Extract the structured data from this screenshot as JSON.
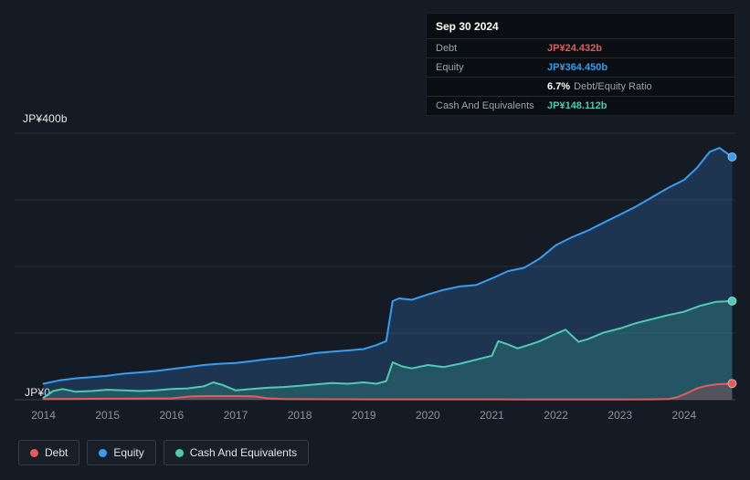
{
  "tooltip": {
    "date": "Sep 30 2024",
    "debt_label": "Debt",
    "debt_value": "JP¥24.432b",
    "equity_label": "Equity",
    "equity_value": "JP¥364.450b",
    "ratio_value": "6.7%",
    "ratio_label": "Debt/Equity Ratio",
    "cash_label": "Cash And Equivalents",
    "cash_value": "JP¥148.112b"
  },
  "axis": {
    "y_top": "JP¥400b",
    "y_bottom": "JP¥0"
  },
  "legend": [
    {
      "label": "Debt",
      "color": "#e25c5c"
    },
    {
      "label": "Equity",
      "color": "#379df1"
    },
    {
      "label": "Cash And Equivalents",
      "color": "#4ecbb1"
    }
  ],
  "colors": {
    "background": "#151b24",
    "grid": "#262c34",
    "grid_zero": "#3a414b",
    "debt": "#e25c5c",
    "equity": "#379df1",
    "cash": "#4ecbb1"
  },
  "chart_data": {
    "type": "area",
    "title": "Debt to Equity history",
    "x_ticks": [
      2014,
      2015,
      2016,
      2017,
      2018,
      2019,
      2020,
      2021,
      2022,
      2023,
      2024
    ],
    "x_range": [
      2013.55,
      2024.8
    ],
    "y_range": [
      0,
      400
    ],
    "ylabel": "JP¥ billions",
    "gridlines": [
      0,
      100,
      200,
      300,
      400
    ],
    "legend_position": "bottom",
    "series": [
      {
        "id": "equity",
        "name": "Equity",
        "color": "#379df1",
        "fill": "rgba(55,130,210,0.25)",
        "points": [
          [
            2014.0,
            24
          ],
          [
            2014.25,
            29
          ],
          [
            2014.5,
            32
          ],
          [
            2014.75,
            34
          ],
          [
            2015.0,
            36
          ],
          [
            2015.25,
            39
          ],
          [
            2015.5,
            41
          ],
          [
            2015.75,
            43
          ],
          [
            2016.0,
            46
          ],
          [
            2016.25,
            49
          ],
          [
            2016.5,
            52
          ],
          [
            2016.75,
            54
          ],
          [
            2017.0,
            55
          ],
          [
            2017.25,
            58
          ],
          [
            2017.5,
            61
          ],
          [
            2017.75,
            63
          ],
          [
            2018.0,
            66
          ],
          [
            2018.25,
            70
          ],
          [
            2018.5,
            72
          ],
          [
            2018.75,
            74
          ],
          [
            2019.0,
            76
          ],
          [
            2019.2,
            82
          ],
          [
            2019.35,
            88
          ],
          [
            2019.45,
            148
          ],
          [
            2019.55,
            152
          ],
          [
            2019.75,
            150
          ],
          [
            2020.0,
            158
          ],
          [
            2020.25,
            165
          ],
          [
            2020.5,
            170
          ],
          [
            2020.75,
            172
          ],
          [
            2021.0,
            182
          ],
          [
            2021.25,
            193
          ],
          [
            2021.5,
            198
          ],
          [
            2021.75,
            212
          ],
          [
            2022.0,
            232
          ],
          [
            2022.25,
            244
          ],
          [
            2022.5,
            254
          ],
          [
            2022.75,
            266
          ],
          [
            2023.0,
            278
          ],
          [
            2023.25,
            290
          ],
          [
            2023.5,
            304
          ],
          [
            2023.75,
            318
          ],
          [
            2024.0,
            330
          ],
          [
            2024.2,
            348
          ],
          [
            2024.4,
            372
          ],
          [
            2024.55,
            378
          ],
          [
            2024.75,
            364.45
          ]
        ]
      },
      {
        "id": "cash",
        "name": "Cash And Equivalents",
        "color": "#4ecbb1",
        "fill": "rgba(70,200,175,0.22)",
        "points": [
          [
            2014.0,
            3
          ],
          [
            2014.15,
            13
          ],
          [
            2014.3,
            16
          ],
          [
            2014.5,
            12
          ],
          [
            2014.75,
            13
          ],
          [
            2015.0,
            15
          ],
          [
            2015.25,
            14
          ],
          [
            2015.5,
            13
          ],
          [
            2015.75,
            14
          ],
          [
            2016.0,
            16
          ],
          [
            2016.25,
            17
          ],
          [
            2016.5,
            20
          ],
          [
            2016.65,
            26
          ],
          [
            2016.8,
            22
          ],
          [
            2017.0,
            14
          ],
          [
            2017.25,
            16
          ],
          [
            2017.5,
            18
          ],
          [
            2017.75,
            19
          ],
          [
            2018.0,
            21
          ],
          [
            2018.25,
            23
          ],
          [
            2018.5,
            25
          ],
          [
            2018.75,
            24
          ],
          [
            2019.0,
            26
          ],
          [
            2019.2,
            24
          ],
          [
            2019.35,
            28
          ],
          [
            2019.45,
            56
          ],
          [
            2019.6,
            50
          ],
          [
            2019.75,
            47
          ],
          [
            2020.0,
            52
          ],
          [
            2020.25,
            49
          ],
          [
            2020.5,
            54
          ],
          [
            2020.75,
            60
          ],
          [
            2021.0,
            66
          ],
          [
            2021.1,
            88
          ],
          [
            2021.25,
            83
          ],
          [
            2021.4,
            77
          ],
          [
            2021.6,
            83
          ],
          [
            2021.75,
            88
          ],
          [
            2022.0,
            99
          ],
          [
            2022.15,
            105
          ],
          [
            2022.35,
            87
          ],
          [
            2022.5,
            91
          ],
          [
            2022.75,
            101
          ],
          [
            2023.0,
            107
          ],
          [
            2023.25,
            115
          ],
          [
            2023.5,
            121
          ],
          [
            2023.75,
            127
          ],
          [
            2024.0,
            132
          ],
          [
            2024.25,
            141
          ],
          [
            2024.5,
            147
          ],
          [
            2024.75,
            148.112
          ]
        ]
      },
      {
        "id": "debt",
        "name": "Debt",
        "color": "#e25c5c",
        "fill": "rgba(224,80,80,0.25)",
        "points": [
          [
            2014.0,
            1
          ],
          [
            2014.5,
            1.2
          ],
          [
            2015.0,
            1.5
          ],
          [
            2015.5,
            1.8
          ],
          [
            2016.0,
            2
          ],
          [
            2016.3,
            5
          ],
          [
            2016.6,
            5.5
          ],
          [
            2017.0,
            5.5
          ],
          [
            2017.3,
            5
          ],
          [
            2017.5,
            2
          ],
          [
            2017.75,
            1
          ],
          [
            2018.0,
            0.8
          ],
          [
            2018.5,
            0.7
          ],
          [
            2019.0,
            0.6
          ],
          [
            2019.5,
            0.5
          ],
          [
            2020.0,
            0.5
          ],
          [
            2020.5,
            0.5
          ],
          [
            2021.0,
            0.5
          ],
          [
            2021.5,
            0.4
          ],
          [
            2022.0,
            0.4
          ],
          [
            2022.5,
            0.4
          ],
          [
            2023.0,
            0.4
          ],
          [
            2023.5,
            0.5
          ],
          [
            2023.75,
            1
          ],
          [
            2023.9,
            4
          ],
          [
            2024.05,
            10
          ],
          [
            2024.2,
            17
          ],
          [
            2024.35,
            21
          ],
          [
            2024.5,
            23
          ],
          [
            2024.75,
            24.432
          ]
        ]
      }
    ]
  }
}
